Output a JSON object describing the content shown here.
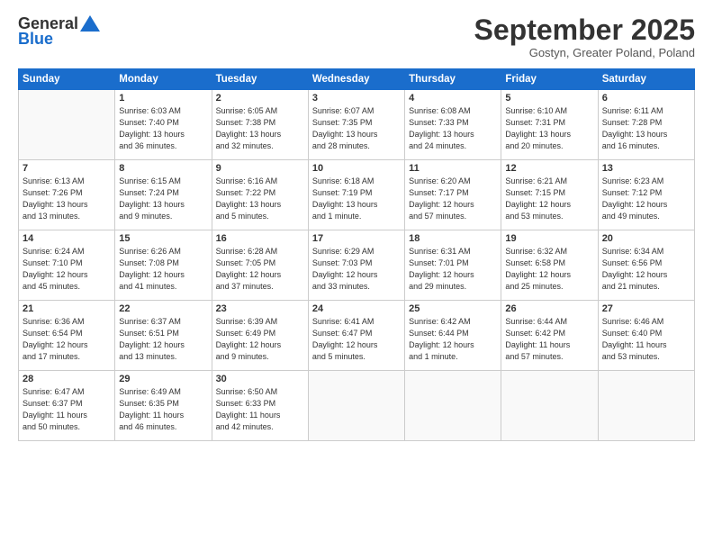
{
  "header": {
    "logo_general": "General",
    "logo_blue": "Blue",
    "month_title": "September 2025",
    "location": "Gostyn, Greater Poland, Poland"
  },
  "days_of_week": [
    "Sunday",
    "Monday",
    "Tuesday",
    "Wednesday",
    "Thursday",
    "Friday",
    "Saturday"
  ],
  "weeks": [
    [
      {
        "day": "",
        "info": ""
      },
      {
        "day": "1",
        "info": "Sunrise: 6:03 AM\nSunset: 7:40 PM\nDaylight: 13 hours\nand 36 minutes."
      },
      {
        "day": "2",
        "info": "Sunrise: 6:05 AM\nSunset: 7:38 PM\nDaylight: 13 hours\nand 32 minutes."
      },
      {
        "day": "3",
        "info": "Sunrise: 6:07 AM\nSunset: 7:35 PM\nDaylight: 13 hours\nand 28 minutes."
      },
      {
        "day": "4",
        "info": "Sunrise: 6:08 AM\nSunset: 7:33 PM\nDaylight: 13 hours\nand 24 minutes."
      },
      {
        "day": "5",
        "info": "Sunrise: 6:10 AM\nSunset: 7:31 PM\nDaylight: 13 hours\nand 20 minutes."
      },
      {
        "day": "6",
        "info": "Sunrise: 6:11 AM\nSunset: 7:28 PM\nDaylight: 13 hours\nand 16 minutes."
      }
    ],
    [
      {
        "day": "7",
        "info": "Sunrise: 6:13 AM\nSunset: 7:26 PM\nDaylight: 13 hours\nand 13 minutes."
      },
      {
        "day": "8",
        "info": "Sunrise: 6:15 AM\nSunset: 7:24 PM\nDaylight: 13 hours\nand 9 minutes."
      },
      {
        "day": "9",
        "info": "Sunrise: 6:16 AM\nSunset: 7:22 PM\nDaylight: 13 hours\nand 5 minutes."
      },
      {
        "day": "10",
        "info": "Sunrise: 6:18 AM\nSunset: 7:19 PM\nDaylight: 13 hours\nand 1 minute."
      },
      {
        "day": "11",
        "info": "Sunrise: 6:20 AM\nSunset: 7:17 PM\nDaylight: 12 hours\nand 57 minutes."
      },
      {
        "day": "12",
        "info": "Sunrise: 6:21 AM\nSunset: 7:15 PM\nDaylight: 12 hours\nand 53 minutes."
      },
      {
        "day": "13",
        "info": "Sunrise: 6:23 AM\nSunset: 7:12 PM\nDaylight: 12 hours\nand 49 minutes."
      }
    ],
    [
      {
        "day": "14",
        "info": "Sunrise: 6:24 AM\nSunset: 7:10 PM\nDaylight: 12 hours\nand 45 minutes."
      },
      {
        "day": "15",
        "info": "Sunrise: 6:26 AM\nSunset: 7:08 PM\nDaylight: 12 hours\nand 41 minutes."
      },
      {
        "day": "16",
        "info": "Sunrise: 6:28 AM\nSunset: 7:05 PM\nDaylight: 12 hours\nand 37 minutes."
      },
      {
        "day": "17",
        "info": "Sunrise: 6:29 AM\nSunset: 7:03 PM\nDaylight: 12 hours\nand 33 minutes."
      },
      {
        "day": "18",
        "info": "Sunrise: 6:31 AM\nSunset: 7:01 PM\nDaylight: 12 hours\nand 29 minutes."
      },
      {
        "day": "19",
        "info": "Sunrise: 6:32 AM\nSunset: 6:58 PM\nDaylight: 12 hours\nand 25 minutes."
      },
      {
        "day": "20",
        "info": "Sunrise: 6:34 AM\nSunset: 6:56 PM\nDaylight: 12 hours\nand 21 minutes."
      }
    ],
    [
      {
        "day": "21",
        "info": "Sunrise: 6:36 AM\nSunset: 6:54 PM\nDaylight: 12 hours\nand 17 minutes."
      },
      {
        "day": "22",
        "info": "Sunrise: 6:37 AM\nSunset: 6:51 PM\nDaylight: 12 hours\nand 13 minutes."
      },
      {
        "day": "23",
        "info": "Sunrise: 6:39 AM\nSunset: 6:49 PM\nDaylight: 12 hours\nand 9 minutes."
      },
      {
        "day": "24",
        "info": "Sunrise: 6:41 AM\nSunset: 6:47 PM\nDaylight: 12 hours\nand 5 minutes."
      },
      {
        "day": "25",
        "info": "Sunrise: 6:42 AM\nSunset: 6:44 PM\nDaylight: 12 hours\nand 1 minute."
      },
      {
        "day": "26",
        "info": "Sunrise: 6:44 AM\nSunset: 6:42 PM\nDaylight: 11 hours\nand 57 minutes."
      },
      {
        "day": "27",
        "info": "Sunrise: 6:46 AM\nSunset: 6:40 PM\nDaylight: 11 hours\nand 53 minutes."
      }
    ],
    [
      {
        "day": "28",
        "info": "Sunrise: 6:47 AM\nSunset: 6:37 PM\nDaylight: 11 hours\nand 50 minutes."
      },
      {
        "day": "29",
        "info": "Sunrise: 6:49 AM\nSunset: 6:35 PM\nDaylight: 11 hours\nand 46 minutes."
      },
      {
        "day": "30",
        "info": "Sunrise: 6:50 AM\nSunset: 6:33 PM\nDaylight: 11 hours\nand 42 minutes."
      },
      {
        "day": "",
        "info": ""
      },
      {
        "day": "",
        "info": ""
      },
      {
        "day": "",
        "info": ""
      },
      {
        "day": "",
        "info": ""
      }
    ]
  ]
}
